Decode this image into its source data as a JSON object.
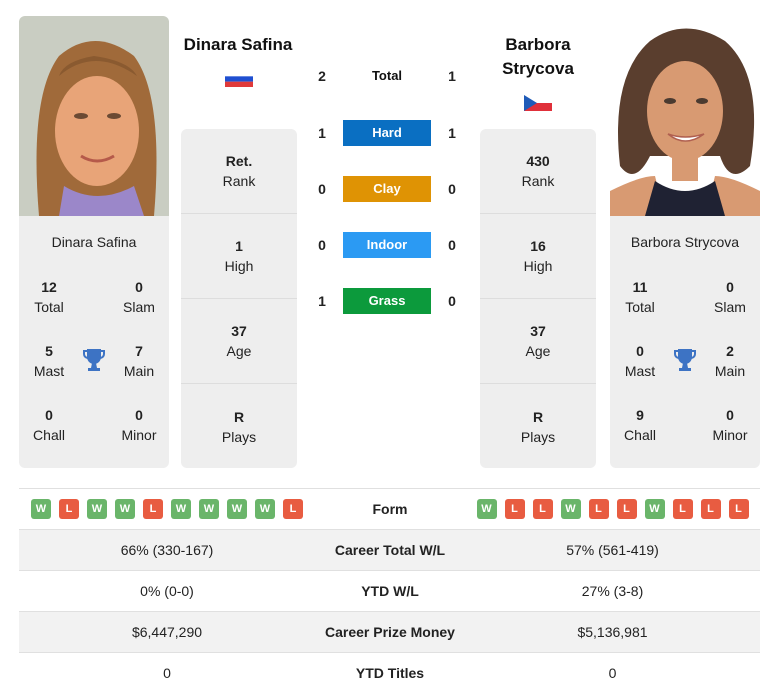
{
  "colors": {
    "hard": "#0a6fc2",
    "clay": "#df9304",
    "indoor": "#2b9af3",
    "grass": "#0c9a3c",
    "win": "#6ab56a",
    "loss": "#e85c41",
    "trophy": "#3d73c4"
  },
  "player1": {
    "name": "Dinara Safina",
    "flag": "russia-flag",
    "card_name": "Dinara Safina",
    "titles": {
      "total": {
        "value": "12",
        "label": "Total"
      },
      "slam": {
        "value": "0",
        "label": "Slam"
      },
      "mast": {
        "value": "5",
        "label": "Mast"
      },
      "main": {
        "value": "7",
        "label": "Main"
      },
      "chall": {
        "value": "0",
        "label": "Chall"
      },
      "minor": {
        "value": "0",
        "label": "Minor"
      }
    },
    "stats": [
      {
        "value": "Ret.",
        "label": "Rank"
      },
      {
        "value": "1",
        "label": "High"
      },
      {
        "value": "37",
        "label": "Age"
      },
      {
        "value": "R",
        "label": "Plays"
      }
    ],
    "form": [
      "W",
      "L",
      "W",
      "W",
      "L",
      "W",
      "W",
      "W",
      "W",
      "L"
    ]
  },
  "player2": {
    "name": "Barbora Strycova",
    "flag": "czech-flag",
    "card_name": "Barbora Strycova",
    "titles": {
      "total": {
        "value": "11",
        "label": "Total"
      },
      "slam": {
        "value": "0",
        "label": "Slam"
      },
      "mast": {
        "value": "0",
        "label": "Mast"
      },
      "main": {
        "value": "2",
        "label": "Main"
      },
      "chall": {
        "value": "9",
        "label": "Chall"
      },
      "minor": {
        "value": "0",
        "label": "Minor"
      }
    },
    "stats": [
      {
        "value": "430",
        "label": "Rank"
      },
      {
        "value": "16",
        "label": "High"
      },
      {
        "value": "37",
        "label": "Age"
      },
      {
        "value": "R",
        "label": "Plays"
      }
    ],
    "form": [
      "W",
      "L",
      "L",
      "W",
      "L",
      "L",
      "W",
      "L",
      "L",
      "L"
    ]
  },
  "h2h": [
    {
      "label": "Total",
      "p1": "2",
      "p2": "1"
    },
    {
      "label": "Hard",
      "p1": "1",
      "p2": "1"
    },
    {
      "label": "Clay",
      "p1": "0",
      "p2": "0"
    },
    {
      "label": "Indoor",
      "p1": "0",
      "p2": "0"
    },
    {
      "label": "Grass",
      "p1": "1",
      "p2": "0"
    }
  ],
  "table": {
    "form_label": "Form",
    "rows": [
      {
        "label": "Career Total W/L",
        "p1": "66% (330-167)",
        "p2": "57% (561-419)"
      },
      {
        "label": "YTD W/L",
        "p1": "0% (0-0)",
        "p2": "27% (3-8)"
      },
      {
        "label": "Career Prize Money",
        "p1": "$6,447,290",
        "p2": "$5,136,981"
      },
      {
        "label": "YTD Titles",
        "p1": "0",
        "p2": "0"
      }
    ]
  }
}
